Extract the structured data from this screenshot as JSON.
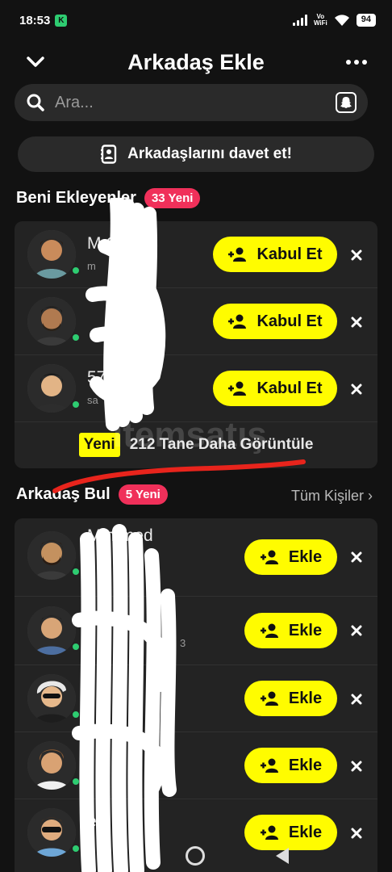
{
  "status_bar": {
    "time": "18:53",
    "app_indicator": "K",
    "vowifi_top": "Vo",
    "vowifi_bottom": "WiFi",
    "battery": "94"
  },
  "header": {
    "title": "Arkadaş Ekle"
  },
  "search": {
    "placeholder": "Ara..."
  },
  "invite": {
    "label": "Arkadaşlarını davet et!"
  },
  "added_me": {
    "title": "Beni Ekleyenler",
    "badge": "33 Yeni",
    "rows": [
      {
        "name": "M        Can",
        "sub": "m",
        "accept_label": "Kabul Et"
      },
      {
        "name": "",
        "sub": "",
        "accept_label": "Kabul Et"
      },
      {
        "name": "          57",
        "sub": "sa",
        "accept_label": "Kabul Et"
      }
    ],
    "more_tag": "Yeni",
    "more_label": "212 Tane Daha Görüntüle"
  },
  "find_friends": {
    "title": "Arkadaş Bul",
    "badge": "5 Yeni",
    "see_all": "Tüm Kişiler ›",
    "rows": [
      {
        "name": "M       mmed",
        "sub": "",
        "add_label": "Ekle"
      },
      {
        "name": "",
        "sub": "3",
        "add_label": "Ekle"
      },
      {
        "name": "             l",
        "sub": "",
        "add_label": "Ekle"
      },
      {
        "name": "",
        "sub": "",
        "add_label": "Ekle"
      },
      {
        "name": "          en",
        "sub": "",
        "add_label": "Ekle"
      }
    ]
  },
  "watermark": "itemsatış",
  "icons": {
    "back": "chevron-down-icon",
    "more": "more-icon",
    "search": "search-icon",
    "scan": "snap-ghost-icon",
    "contacts": "contacts-icon",
    "add_friend": "add-person-icon",
    "dismiss": "close-icon"
  },
  "colors": {
    "accent_yellow": "#fffc00",
    "badge_red": "#f0305a",
    "online_green": "#2ecc71"
  }
}
